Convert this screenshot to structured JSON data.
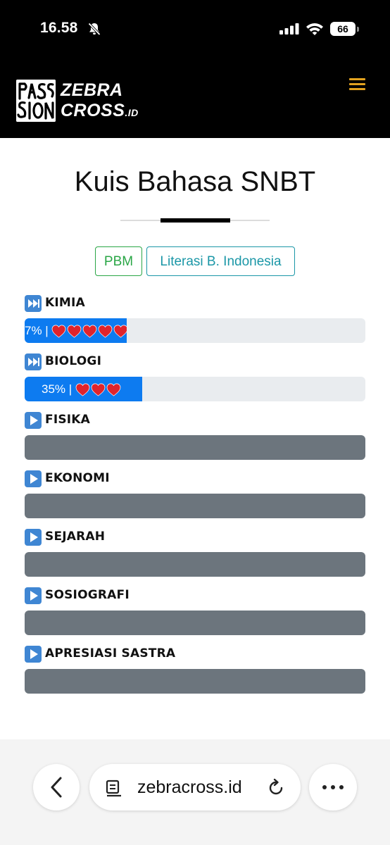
{
  "status_bar": {
    "time": "16.58",
    "battery": "66"
  },
  "header": {
    "logo_line1": "ZEBRA",
    "logo_line2": "CROSS",
    "logo_suffix": ".ID",
    "logo_mark_text": "PASSION",
    "menu_icon": "hamburger-menu-icon",
    "accent_color": "#e2a21f"
  },
  "page": {
    "title": "Kuis Bahasa SNBT"
  },
  "tabs": [
    {
      "label": "PBM",
      "color": "#2aa646"
    },
    {
      "label": "Literasi B. Indonesia",
      "color": "#1b97a7"
    }
  ],
  "subjects": [
    {
      "label": "KIMIA",
      "icon": "fast-forward-icon",
      "progress_text": "7% | ",
      "hearts": 5,
      "fill_percent": 30
    },
    {
      "label": "BIOLOGI",
      "icon": "fast-forward-icon",
      "progress_text": "35% | ",
      "hearts": 3,
      "fill_percent": 35
    },
    {
      "label": "FISIKA",
      "icon": "play-icon"
    },
    {
      "label": "EKONOMI",
      "icon": "play-icon"
    },
    {
      "label": "SEJARAH",
      "icon": "play-icon"
    },
    {
      "label": "SOSIOGRAFI",
      "icon": "play-icon"
    },
    {
      "label": "APRESIASI SASTRA",
      "icon": "play-icon"
    }
  ],
  "colors": {
    "progress_fill": "#0d7bf0",
    "progress_track": "#e9ecef",
    "locked_bar": "#6c757d",
    "heart": "#e0242c"
  },
  "browser": {
    "url": "zebracross.id"
  }
}
